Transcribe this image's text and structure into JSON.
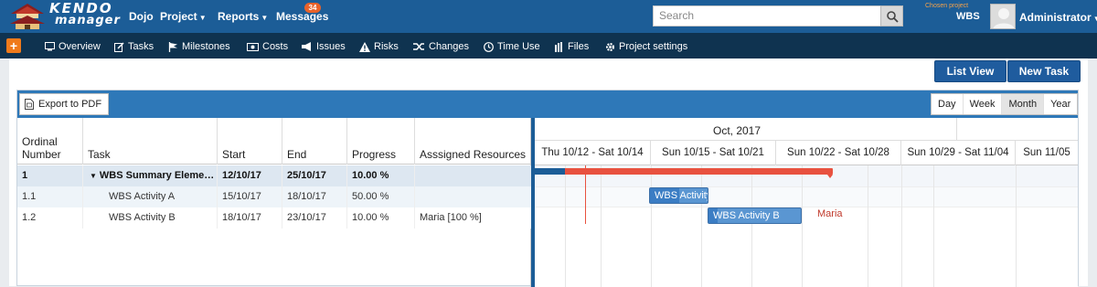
{
  "brand": {
    "line1": "KENDO",
    "line2": "manager"
  },
  "nav": {
    "dojo": "Dojo",
    "project": "Project",
    "reports": "Reports",
    "messages": "Messages",
    "messages_badge": "34"
  },
  "search": {
    "placeholder": "Search"
  },
  "project_chooser": {
    "label": "Chosen project",
    "value": "WBS"
  },
  "user": {
    "name": "Administrator"
  },
  "subnav": {
    "plus": "+",
    "items": [
      "Overview",
      "Tasks",
      "Milestones",
      "Costs",
      "Issues",
      "Risks",
      "Changes",
      "Time Use",
      "Files",
      "Project settings"
    ]
  },
  "buttons": {
    "list_view": "List View",
    "new_task": "New Task",
    "export_pdf": "Export to PDF"
  },
  "view_modes": {
    "day": "Day",
    "week": "Week",
    "month": "Month",
    "year": "Year",
    "active": "Month"
  },
  "grid": {
    "headers": {
      "ordinal": "Ordinal Number",
      "task": "Task",
      "start": "Start",
      "end": "End",
      "progress": "Progress",
      "resources": "Asssigned Resources"
    },
    "rows": [
      {
        "ordinal": "1",
        "task": "WBS Summary Eleme…",
        "start": "12/10/17",
        "end": "25/10/17",
        "progress": "10.00 %",
        "resources": ""
      },
      {
        "ordinal": "1.1",
        "task": "WBS Activity A",
        "start": "15/10/17",
        "end": "18/10/17",
        "progress": "50.00 %",
        "resources": ""
      },
      {
        "ordinal": "1.2",
        "task": "WBS Activity B",
        "start": "18/10/17",
        "end": "23/10/17",
        "progress": "10.00 %",
        "resources": "Maria [100 %]"
      }
    ]
  },
  "timeline": {
    "month": "Oct, 2017",
    "weeks": [
      "Thu 10/12 - Sat 10/14",
      "Sun 10/15 - Sat 10/21",
      "Sun 10/22 - Sat 10/28",
      "Sun 10/29 - Sat 11/04",
      "Sun 11/05"
    ],
    "bars": {
      "activity_a": "WBS Activity",
      "activity_b": "WBS Activity B",
      "resource_label": "Maria"
    },
    "summary_progress": 0.1,
    "activity_a_progress": 0.5,
    "activity_b_progress": 0.1
  },
  "colors": {
    "header_blue": "#1c5d97",
    "subnav": "#0f3350",
    "summary_bar": "#e8513f",
    "task_bar": "#3b7dc4",
    "today_line": "#e8513f",
    "badge": "#e8622a"
  }
}
